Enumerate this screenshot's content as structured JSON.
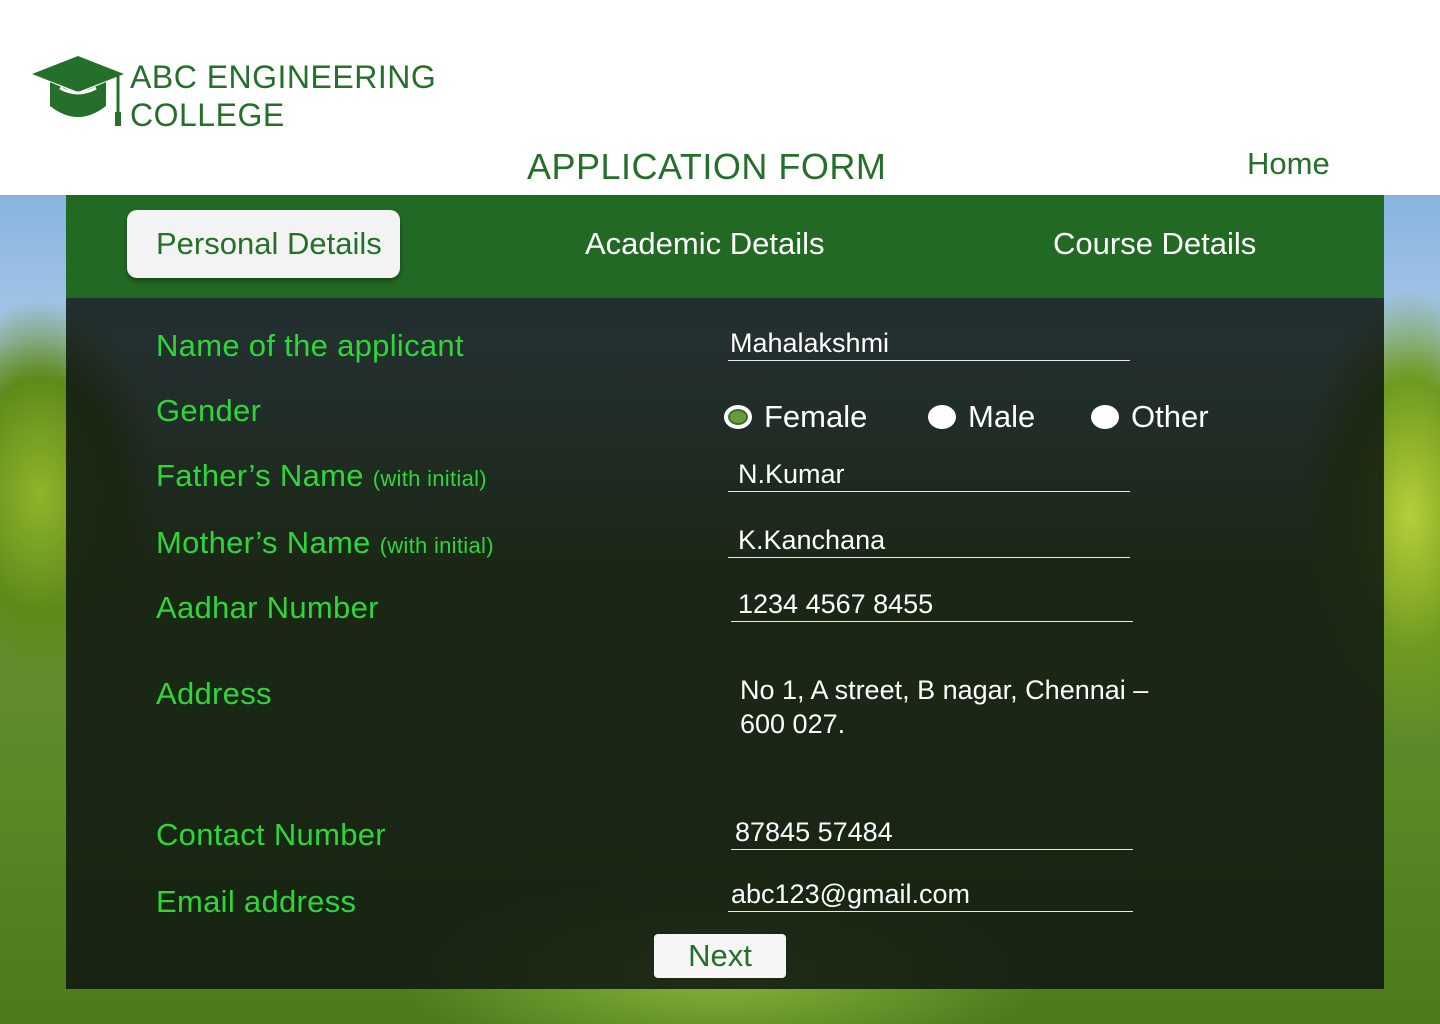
{
  "header": {
    "college_name_line1": "ABC ENGINEERING",
    "college_name_line2": "COLLEGE",
    "form_title": "APPLICATION FORM",
    "home_link": "Home"
  },
  "tabs": [
    {
      "label": "Personal Details",
      "active": true
    },
    {
      "label": "Academic Details",
      "active": false
    },
    {
      "label": "Course Details",
      "active": false
    }
  ],
  "form": {
    "name_label": "Name of the applicant",
    "name_value": "Mahalakshmi",
    "gender_label": "Gender",
    "gender_options": [
      "Female",
      "Male",
      "Other"
    ],
    "gender_selected": "Female",
    "father_label": "Father’s Name",
    "father_hint": "(with initial)",
    "father_value": "N.Kumar",
    "mother_label": "Mother’s Name",
    "mother_hint": "(with initial)",
    "mother_value": "K.Kanchana",
    "aadhar_label": "Aadhar Number",
    "aadhar_value": "1234 4567 8455",
    "address_label": "Address",
    "address_line1": "No 1, A street, B nagar, Chennai –",
    "address_line2": "600 027.",
    "contact_label": "Contact Number",
    "contact_value": "87845 57484",
    "email_label": "Email address",
    "email_value": "abc123@gmail.com",
    "next_label": "Next"
  },
  "colors": {
    "brand_green": "#24702b",
    "tab_bar": "#226a24",
    "label_green": "#2ed63a"
  }
}
